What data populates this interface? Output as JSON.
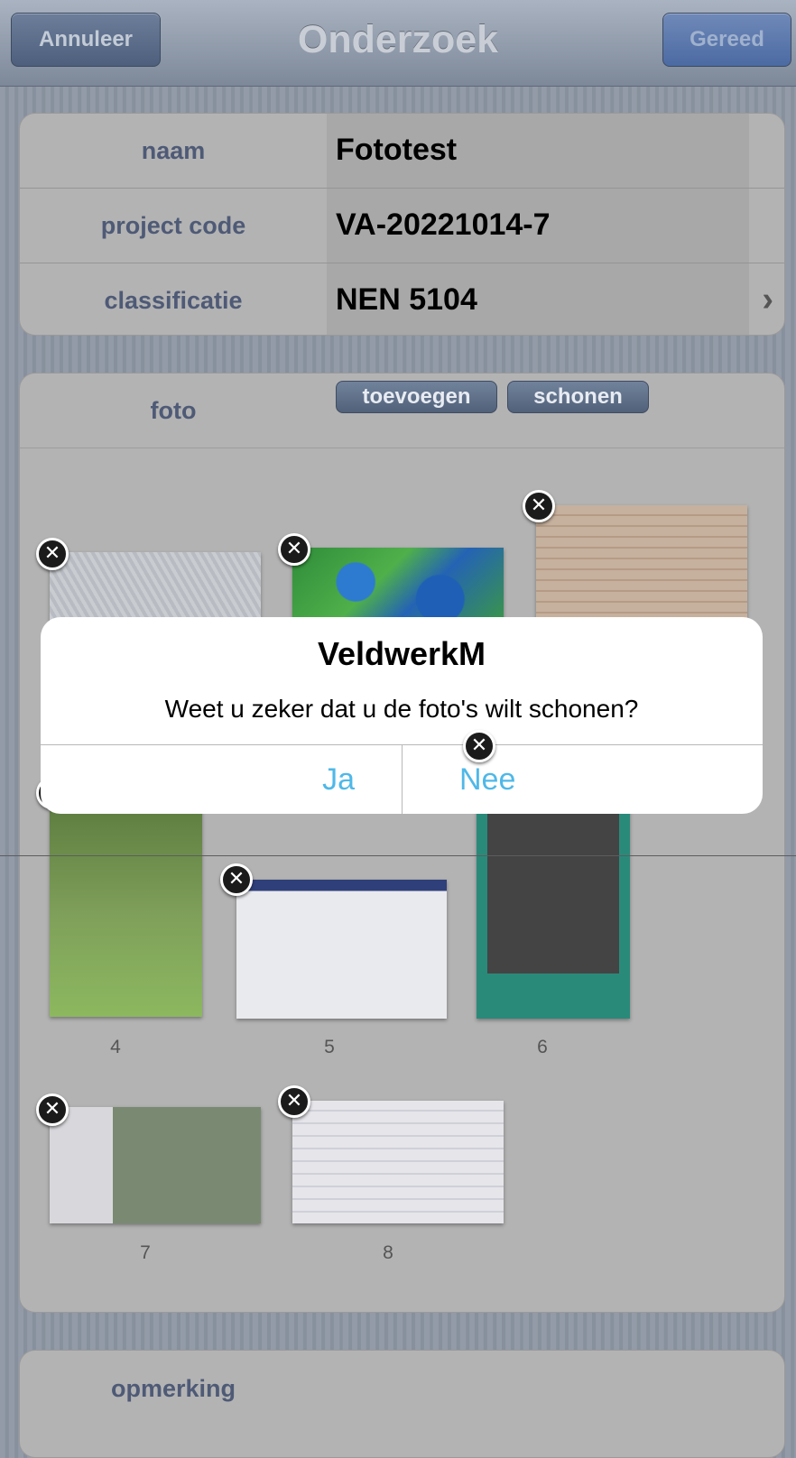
{
  "navbar": {
    "title": "Onderzoek",
    "cancel_label": "Annuleer",
    "done_label": "Gereed"
  },
  "info_rows": [
    {
      "label": "naam",
      "value": "Fototest"
    },
    {
      "label": "project code",
      "value": "VA-20221014-7"
    },
    {
      "label": "classificatie",
      "value": "NEN 5104"
    }
  ],
  "photos": {
    "label": "foto",
    "add_label": "toevoegen",
    "clean_label": "schonen",
    "items": [
      {
        "caption": "4"
      },
      {
        "caption": "5"
      },
      {
        "caption": "6"
      },
      {
        "caption": "7"
      },
      {
        "caption": "8"
      }
    ],
    "delete_glyph": "✕"
  },
  "comment": {
    "label": "opmerking"
  },
  "alert": {
    "title": "VeldwerkM",
    "message": "Weet u zeker dat u de foto's wilt schonen?",
    "yes_label": "Ja",
    "no_label": "Nee"
  },
  "icons": {
    "chevron": "›"
  },
  "colors": {
    "label_text": "#4e5a76",
    "alert_button": "#4fb8e8",
    "done_button": "#4c6aa3"
  }
}
